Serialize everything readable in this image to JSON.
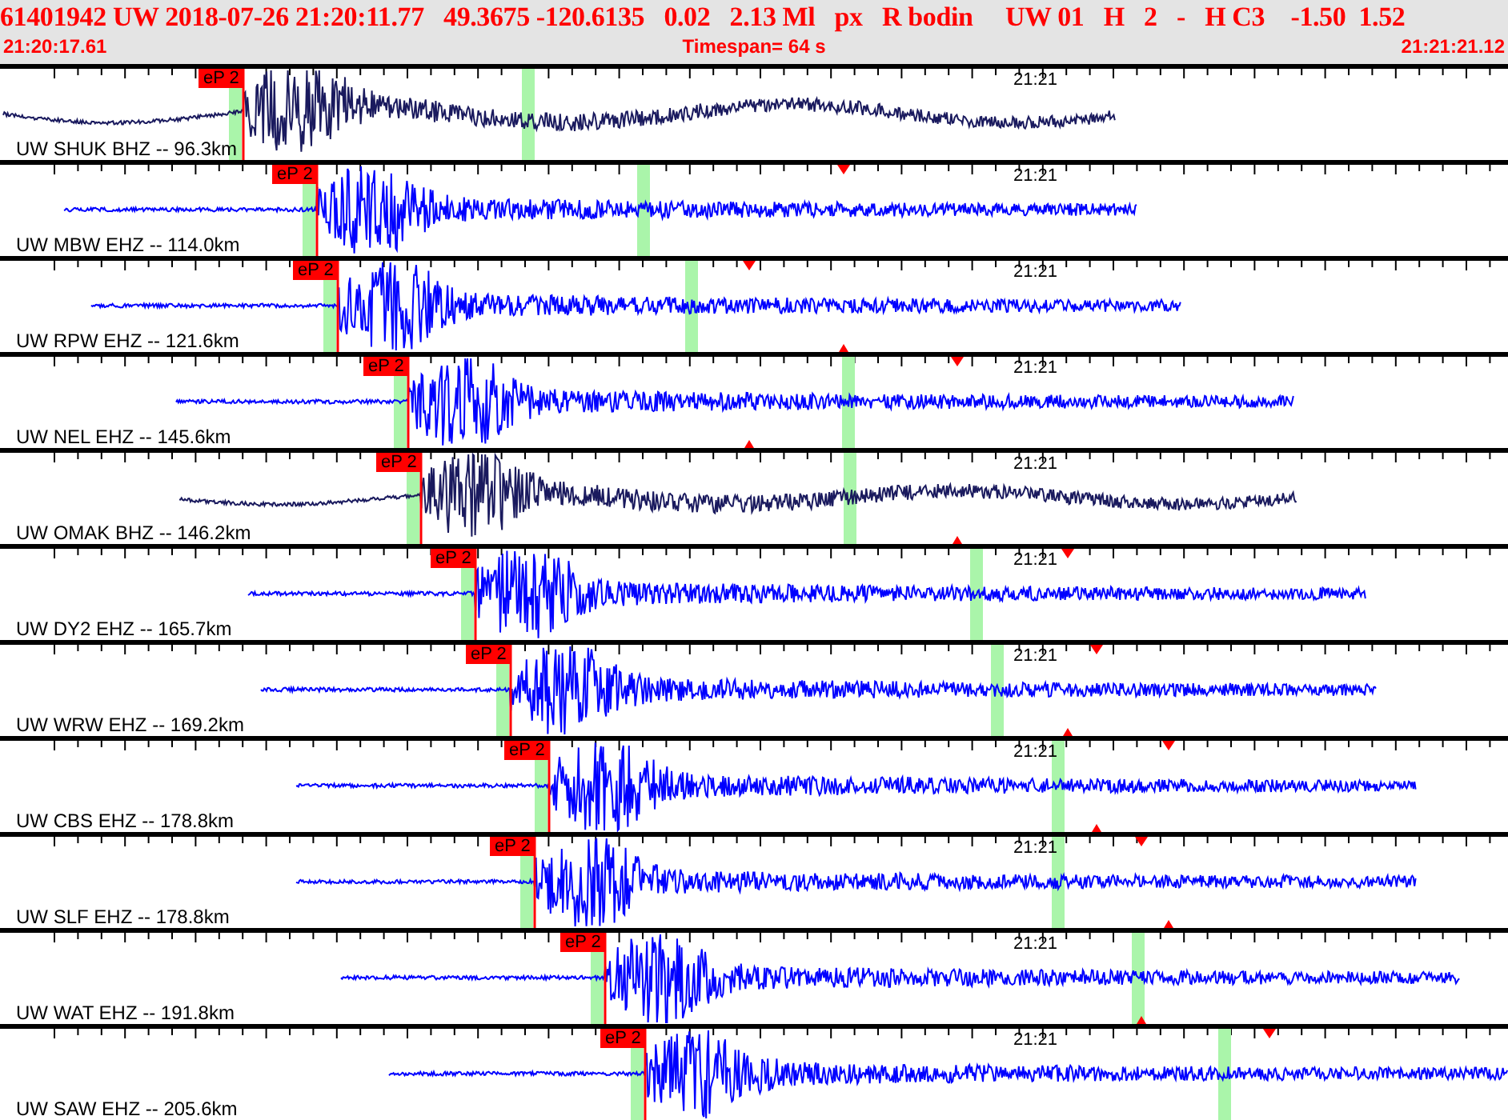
{
  "header": {
    "summary": "61401942 UW 2018-07-26 21:20:11.77   49.3675 -120.6135   0.02   2.13 Ml   px   R bodin     UW 01   H   2   -   H C3    -1.50  1.52",
    "start_time": "21:20:17.61",
    "timespan": "Timespan=  64 s",
    "end_time": "21:21:21.12"
  },
  "traces": [
    {
      "label": "UW SHUK BHZ -- 96.3km",
      "color": "#1a1a5e",
      "pick": "eP 2",
      "time_label": "21:21"
    },
    {
      "label": "UW MBW EHZ -- 114.0km",
      "color": "#0000ff",
      "pick": "eP 2",
      "time_label": "21:21"
    },
    {
      "label": "UW RPW EHZ -- 121.6km",
      "color": "#0000ff",
      "pick": "eP 2",
      "time_label": "21:21"
    },
    {
      "label": "UW NEL EHZ -- 145.6km",
      "color": "#0000ff",
      "pick": "eP 2",
      "time_label": "21:21"
    },
    {
      "label": "UW OMAK BHZ -- 146.2km",
      "color": "#1a1a5e",
      "pick": "eP 2",
      "time_label": "21:21"
    },
    {
      "label": "UW DY2 EHZ -- 165.7km",
      "color": "#0000ff",
      "pick": "eP 2",
      "time_label": "21:21"
    },
    {
      "label": "UW WRW EHZ -- 169.2km",
      "color": "#0000ff",
      "pick": "eP 2",
      "time_label": "21:21"
    },
    {
      "label": "UW CBS EHZ -- 178.8km",
      "color": "#0000ff",
      "pick": "eP 2",
      "time_label": "21:21"
    },
    {
      "label": "UW SLF EHZ -- 178.8km",
      "color": "#0000ff",
      "pick": "eP 2",
      "time_label": "21:21"
    },
    {
      "label": "UW WAT EHZ -- 191.8km",
      "color": "#0000ff",
      "pick": "eP 2",
      "time_label": "21:21"
    },
    {
      "label": "UW SAW EHZ -- 205.6km",
      "color": "#0000ff",
      "pick": "eP 2",
      "time_label": "21:21"
    }
  ]
}
